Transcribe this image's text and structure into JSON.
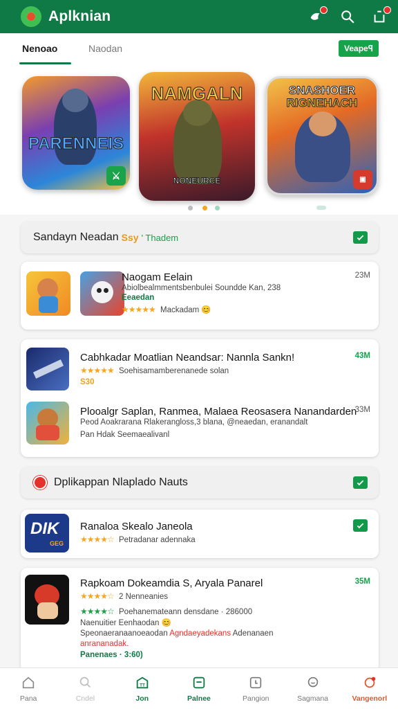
{
  "header": {
    "title": "Aplknian",
    "icons": [
      "notification-icon",
      "search-icon",
      "share-icon"
    ]
  },
  "tabs": {
    "items": [
      "Nenoao",
      "Naodan"
    ],
    "active": 0,
    "action_label": "Veapeꟼ"
  },
  "carousel": {
    "banners": [
      {
        "title": "PARENNEIS"
      },
      {
        "title": "NAMGALN",
        "caption": "NONEURCE"
      },
      {
        "title_line1": "SNASHOER",
        "title_line2": "RIGNEHACH"
      }
    ],
    "dots": 4,
    "active_dot": 2
  },
  "section1": {
    "title": "Sandayn Neadan",
    "tag": "Ssy",
    "link": "' Thadem"
  },
  "featured_app": {
    "title": "Naogam Eelain",
    "line1": "Abiolbealmmentsbenbulei Soundde Kan, 238",
    "line2": "Eeaedan",
    "stars": "★★★★★",
    "rating_text": "Mackadam 😊",
    "size": "23M"
  },
  "list_apps": [
    {
      "title": "Cabhkadar Moatlian Neandsar: Nannla Sankn!",
      "line1": "Soehisamamberenanede solan",
      "line2": "S30",
      "stars": "★★★★★",
      "size": "43M"
    },
    {
      "title": "Plooalgr Saplan, Ranmea, Malaea Reosasera Nanandarden",
      "line1": "Peod Aoakrarana Rlakerangloss,3 blana, @neaedan, eranandalt",
      "line2": "Pan Hdak Seemaealivanl",
      "size": "33M"
    }
  ],
  "section2": {
    "title": "Dplikappan Nlaplado Nauts"
  },
  "app_item": {
    "title": "Ranaloa Skealo Janeola",
    "stars": "★★★★☆",
    "line1": "Petradanar adennaka",
    "logo_text": "DIK",
    "logo_sub": "GEG"
  },
  "last_app": {
    "title": "Rapkoam Dokeamdia S, Aryala Panarel",
    "stars": "★★★★☆",
    "count": "2 Nenneanies",
    "green_stars": "★★★★☆",
    "line1": "Poehanemateann densdane · 286000",
    "line2": "Naenuitier Eenhaodan 😊",
    "line3_a": "Speonaeranaanoeaodan",
    "line3_b": "Agndaeyadekans",
    "line3_c": "Adenanaen",
    "line4": "anrananadak.",
    "line5": "Panenaes · 3:60)",
    "size": "35M"
  },
  "bottom_nav": {
    "items": [
      "Pana",
      "Cndel",
      "Jon",
      "Palnee",
      "Pangion",
      "Sagmana",
      "Vangenorl"
    ],
    "active": 3
  },
  "colors": {
    "primary": "#0f7a45",
    "accent_green": "#16a34a",
    "alert": "#e4312b",
    "star": "#f5a623"
  }
}
